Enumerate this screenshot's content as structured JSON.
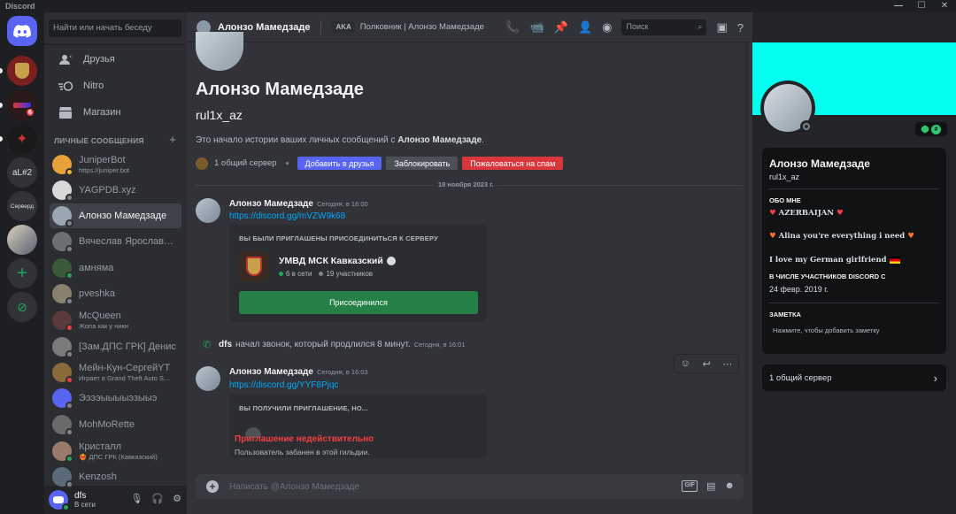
{
  "app": {
    "title": "Discord",
    "window_controls": [
      "—",
      "☐",
      "✕"
    ]
  },
  "servers": [
    {
      "label": "",
      "badge": ""
    },
    {
      "label": "",
      "badge": "6"
    },
    {
      "label": "",
      "badge": ""
    },
    {
      "label": "aL#2",
      "badge": ""
    },
    {
      "label": "Серверд",
      "badge": ""
    },
    {
      "label": "",
      "badge": ""
    }
  ],
  "sidebar": {
    "search_placeholder": "Найти или начать беседу",
    "nav": [
      {
        "label": "Друзья",
        "icon": "friends-icon"
      },
      {
        "label": "Nitro",
        "icon": "nitro-icon"
      },
      {
        "label": "Магазин",
        "icon": "shop-icon"
      }
    ],
    "dm_header": "ЛИЧНЫЕ СООБЩЕНИЯ",
    "dm_add": "+",
    "dms": [
      {
        "name": "JuniperBot",
        "sub": "https://juniper.bot",
        "color": "#e8a13a",
        "status": "#f0b232"
      },
      {
        "name": "YAGPDB.xyz",
        "sub": "",
        "color": "#d9d9d9",
        "status": "#80848e"
      },
      {
        "name": "Алонзо Мамедзаде",
        "sub": "",
        "color": "#9aa7b3",
        "status": "#80848e"
      },
      {
        "name": "Вячеслав Ярославович",
        "sub": "",
        "color": "#6b7075",
        "status": "#80848e"
      },
      {
        "name": "амняма",
        "sub": "",
        "color": "#3a5a3a",
        "status": "#23a55a"
      },
      {
        "name": "pveshka",
        "sub": "",
        "color": "#8a8070",
        "status": "#80848e"
      },
      {
        "name": "McQueen",
        "sub": "Жопа как у ники",
        "color": "#5a3a3a",
        "status": "#f23f43"
      },
      {
        "name": "[Зам.ДПС ГРК] Денис",
        "sub": "",
        "color": "#7a7a7a",
        "status": "#80848e"
      },
      {
        "name": "Мейн-Кун-СергейYT",
        "sub": "Играет в Grand Theft Auto S...",
        "color": "#8a6a3a",
        "status": "#f23f43"
      },
      {
        "name": "Ээээыыыыэзыыэ",
        "sub": "",
        "color": "#5865f2",
        "status": "#80848e"
      },
      {
        "name": "MohMoRette",
        "sub": "",
        "color": "#6a6a6a",
        "status": "#80848e"
      },
      {
        "name": "Кристалл",
        "sub": "❤️‍🔥 ДПС ГРК (Кавказский)",
        "color": "#9a7a6a",
        "status": "#23a55a"
      },
      {
        "name": "Kenzosh",
        "sub": "",
        "color": "#5a6a7a",
        "status": "#80848e"
      }
    ],
    "user": {
      "name": "dfs",
      "status": "В сети"
    }
  },
  "header": {
    "name": "Алонзо Мамедзаде",
    "aka": "AKA",
    "aka_text": "Полковник | Алонзо Мамедзаде",
    "search_placeholder": "Поиск"
  },
  "intro": {
    "name": "Алонзо Мамедзаде",
    "username": "rul1x_az",
    "desc_prefix": "Это начало истории ваших личных сообщений с ",
    "desc_name": "Алонзо Мамедзаде",
    "desc_suffix": ".",
    "mutual": "1 общий сервер",
    "add_friend": "Добавить в друзья",
    "block": "Заблокировать",
    "report": "Пожаловаться на спам"
  },
  "date_separator": "18 ноября 2023 г.",
  "message1": {
    "author": "Алонзо Мамедзаде",
    "time": "Сегодня, в 16:00",
    "link": "https://discord.gg/mVZW9k68",
    "invite_title": "ВЫ БЫЛИ ПРИГЛАШЕНЫ ПРИСОЕДИНИТЬСЯ К СЕРВЕРУ",
    "guild_name": "УМВД МСК Кавказский",
    "online": "6 в сети",
    "members": "19 участников",
    "joined": "Присоединился"
  },
  "call": {
    "user": "dfs",
    "text": "начал звонок, который продлился 8 минут.",
    "time": "Сегодня, в 16:01"
  },
  "message2": {
    "author": "Алонзо Мамедзаде",
    "time": "Сегодня, в 16:03",
    "link": "https://discord.gg/YYF8Pjqc",
    "invite_title": "ВЫ ПОЛУЧИЛИ ПРИГЛАШЕНИЕ, НО...",
    "invalid": "Приглашение недействительно",
    "invalid_sub": "Пользователь забанен в этой гильдии."
  },
  "composer": {
    "placeholder": "Написать @Алонзо Мамедзаде",
    "gif": "GIF"
  },
  "profile": {
    "banner_color": "#00ffee",
    "name": "Алонзо Мамедзаде",
    "username": "rul1x_az",
    "about_header": "ОБО МНЕ",
    "bio1": "AZERBAIJAN",
    "bio2": "Alina you're everything i need",
    "bio3": "I love my German girlfriend",
    "member_since_header": "В ЧИСЛЕ УЧАСТНИКОВ DISCORD С",
    "member_since": "24 февр. 2019 г.",
    "note_header": "ЗАМЕТКА",
    "note_placeholder": "Нажмите, чтобы добавить заметку",
    "mutual_servers": "1 общий сервер"
  }
}
